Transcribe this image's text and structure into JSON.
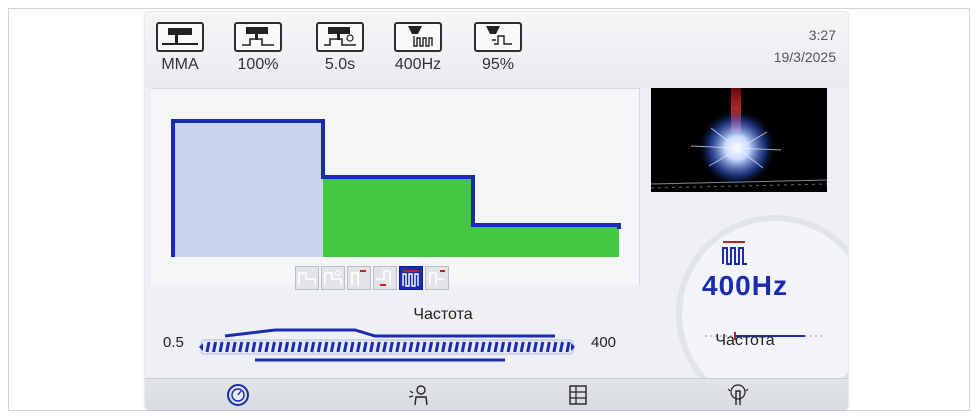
{
  "status": {
    "items": [
      {
        "icon": "stick-electrode-icon",
        "label": "MMA"
      },
      {
        "icon": "torch-arc-force-icon",
        "label": "100%"
      },
      {
        "icon": "torch-postflow-icon",
        "label": "5.0s"
      },
      {
        "icon": "pulse-frequency-icon",
        "label": "400Hz"
      },
      {
        "icon": "pulse-duty-icon",
        "label": "95%"
      }
    ],
    "time": "3:27",
    "date": "19/3/2025"
  },
  "waveform": {
    "levels": [
      1.0,
      0.67,
      0.25
    ],
    "active_mode_index": 4,
    "modes": [
      "2t-icon",
      "4t-icon",
      "preflow-icon",
      "downslope-icon",
      "pulse-icon",
      "spot-icon"
    ]
  },
  "slider": {
    "title": "Частота",
    "min": "0.5",
    "max": "400",
    "value": 400,
    "range": [
      0.5,
      400
    ]
  },
  "parameter": {
    "value": "400Hz",
    "label": "Частота"
  },
  "bottom": {
    "items": [
      "dial-icon",
      "welder-icon",
      "menu-icon",
      "touch-icon"
    ]
  },
  "colors": {
    "accent": "#1a2bb0",
    "green": "#4ccc4c",
    "screen_bg": "#eef0f3"
  }
}
